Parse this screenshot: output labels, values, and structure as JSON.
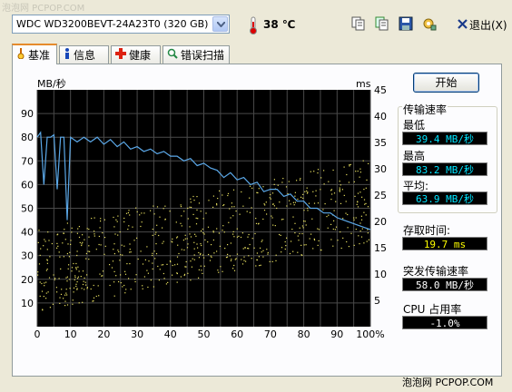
{
  "watermark": "泡泡网 PCPOP.COM",
  "toolbar": {
    "drive": "WDC WD3200BEVT-24A23T0 (320 GB)",
    "temperature": "38 ℃",
    "exit_label": "退出(X)"
  },
  "tabs": [
    {
      "label": "基准",
      "icon": "benchmark-icon"
    },
    {
      "label": "信息",
      "icon": "info-icon"
    },
    {
      "label": "健康",
      "icon": "health-cross-icon"
    },
    {
      "label": "错误扫描",
      "icon": "magnifier-icon"
    }
  ],
  "start_label": "开始",
  "stats": {
    "transfer_rate_title": "传输速率",
    "min_label": "最低",
    "min_value": "39.4 MB/秒",
    "max_label": "最高",
    "max_value": "83.2 MB/秒",
    "avg_label": "平均:",
    "avg_value": "63.9 MB/秒",
    "access_time_label": "存取时间:",
    "access_time_value": "19.7 ms",
    "burst_label": "突发传输速率",
    "burst_value": "58.0 MB/秒",
    "cpu_label": "CPU 占用率",
    "cpu_value": "-1.0%"
  },
  "colors": {
    "chart_bg": "#000000",
    "grid": "#4a4a4a",
    "transfer_line": "#5ba8e8",
    "access_points": "#e8e060",
    "value_blue": "#00e5ff",
    "value_yellow": "#ffff00"
  },
  "chart_data": {
    "type": "line",
    "left_unit": "MB/秒",
    "right_unit": "ms",
    "x_ticks": [
      "0",
      "10",
      "20",
      "30",
      "40",
      "50",
      "60",
      "70",
      "80",
      "90",
      "100%"
    ],
    "left_ticks": [
      "10",
      "20",
      "30",
      "40",
      "50",
      "60",
      "70",
      "80",
      "90"
    ],
    "right_ticks": [
      "5",
      "10",
      "15",
      "20",
      "25",
      "30",
      "35",
      "40",
      "45"
    ],
    "xlim": [
      0,
      100
    ],
    "ylim_left": [
      0,
      100
    ],
    "ylim_right": [
      0,
      45
    ],
    "grid": true,
    "series": [
      {
        "kind": "transfer_rate",
        "x": [
          0,
          1,
          2,
          3,
          4,
          5,
          6,
          7,
          8,
          9,
          10,
          12,
          14,
          16,
          18,
          20,
          22,
          24,
          26,
          28,
          30,
          32,
          34,
          36,
          38,
          40,
          42,
          44,
          46,
          48,
          50,
          52,
          54,
          56,
          58,
          60,
          62,
          64,
          66,
          68,
          70,
          72,
          74,
          76,
          78,
          80,
          82,
          84,
          86,
          88,
          90,
          92,
          94,
          96,
          98,
          100
        ],
        "y": [
          80,
          82,
          60,
          80,
          80,
          81,
          58,
          80,
          80,
          45,
          80,
          78,
          80,
          78,
          80,
          77,
          79,
          76,
          78,
          75,
          76,
          74,
          75,
          73,
          74,
          72,
          72,
          70,
          71,
          68,
          69,
          67,
          66,
          63,
          65,
          62,
          63,
          60,
          61,
          57,
          58,
          58,
          55,
          56,
          53,
          53,
          50,
          50,
          48,
          48,
          46,
          45,
          44,
          43,
          42,
          41
        ]
      }
    ],
    "access_time_points": {
      "description_range_ms": [
        8,
        35
      ]
    }
  }
}
